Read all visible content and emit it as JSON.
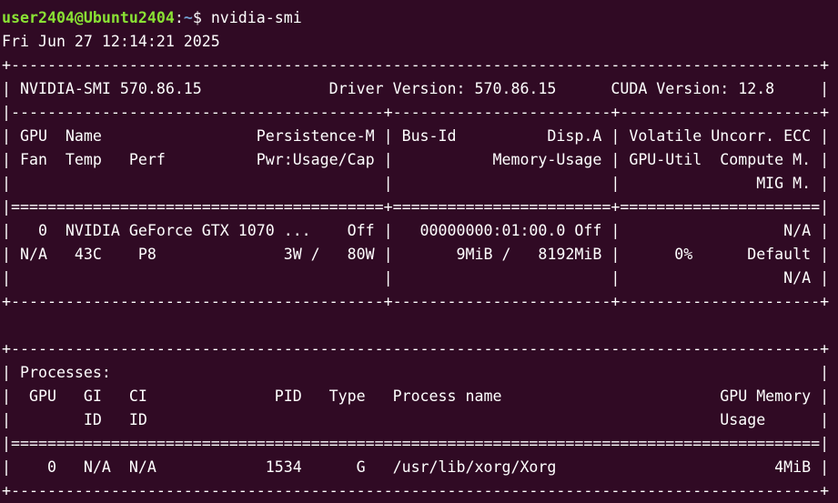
{
  "terminal": {
    "prompt_user": "user2404@Ubuntu2404",
    "prompt_sep": ":",
    "prompt_path": "~",
    "prompt_symbol": "$ ",
    "command": "nvidia-smi",
    "output": [
      "Fri Jun 27 12:14:21 2025",
      "+-----------------------------------------------------------------------------------------+",
      "| NVIDIA-SMI 570.86.15              Driver Version: 570.86.15      CUDA Version: 12.8     |",
      "|-----------------------------------------+------------------------+----------------------+",
      "| GPU  Name                 Persistence-M | Bus-Id          Disp.A | Volatile Uncorr. ECC |",
      "| Fan  Temp   Perf          Pwr:Usage/Cap |           Memory-Usage | GPU-Util  Compute M. |",
      "|                                         |                        |               MIG M. |",
      "|=========================================+========================+======================|",
      "|   0  NVIDIA GeForce GTX 1070 ...    Off |   00000000:01:00.0 Off |                  N/A |",
      "| N/A   43C    P8              3W /   80W |       9MiB /   8192MiB |      0%      Default |",
      "|                                         |                        |                  N/A |",
      "+-----------------------------------------+------------------------+----------------------+",
      "",
      "+-----------------------------------------------------------------------------------------+",
      "| Processes:                                                                              |",
      "|  GPU   GI   CI              PID   Type   Process name                        GPU Memory |",
      "|        ID   ID                                                               Usage      |",
      "|=========================================================================================|",
      "|    0   N/A  N/A            1534      G   /usr/lib/xorg/Xorg                        4MiB |",
      "+-----------------------------------------------------------------------------------------+"
    ]
  },
  "colors": {
    "background": "#300a24",
    "prompt_user": "#8ae234",
    "prompt_path": "#729fcf",
    "text": "#ffffff"
  }
}
